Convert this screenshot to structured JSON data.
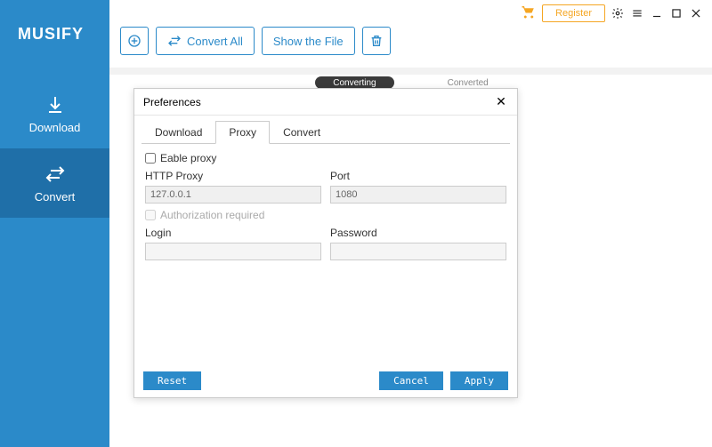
{
  "app": {
    "name": "MUSIFY"
  },
  "titlebar": {
    "register": "Register"
  },
  "sidebar": {
    "items": [
      {
        "label": "Download"
      },
      {
        "label": "Convert"
      }
    ]
  },
  "toolbar": {
    "convert_all": "Convert All",
    "show_file": "Show the File"
  },
  "main_tabs": {
    "converting": "Converting",
    "converted": "Converted"
  },
  "modal": {
    "title": "Preferences",
    "tabs": {
      "download": "Download",
      "proxy": "Proxy",
      "convert": "Convert"
    },
    "proxy": {
      "enable_label": "Eable proxy",
      "http_label": "HTTP Proxy",
      "http_value": "127.0.0.1",
      "port_label": "Port",
      "port_value": "1080",
      "auth_label": "Authorization required",
      "login_label": "Login",
      "login_value": "",
      "password_label": "Password",
      "password_value": ""
    },
    "buttons": {
      "reset": "Reset",
      "cancel": "Cancel",
      "apply": "Apply"
    }
  }
}
